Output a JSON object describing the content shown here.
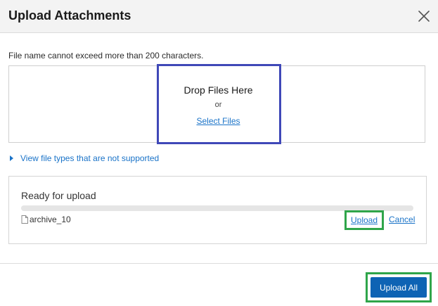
{
  "dialog": {
    "title": "Upload Attachments",
    "close_icon": "close-icon"
  },
  "hint": "File name cannot exceed more than 200 characters.",
  "dropzone": {
    "title": "Drop Files Here",
    "or": "or",
    "select_label": "Select Files"
  },
  "file_types": {
    "toggle_icon": "caret-right-icon",
    "label": "View file types that are not supported"
  },
  "upload_queue": {
    "status": "Ready for upload",
    "progress_percent": 0,
    "file": {
      "icon": "file-icon",
      "name": "archive_10",
      "upload_label": "Upload",
      "cancel_label": "Cancel"
    }
  },
  "footer": {
    "upload_all_label": "Upload All"
  },
  "colors": {
    "link": "#1a73c8",
    "primary_button": "#0e63b4",
    "highlight_blue": "#3f48b8",
    "highlight_green": "#2fa54a"
  }
}
